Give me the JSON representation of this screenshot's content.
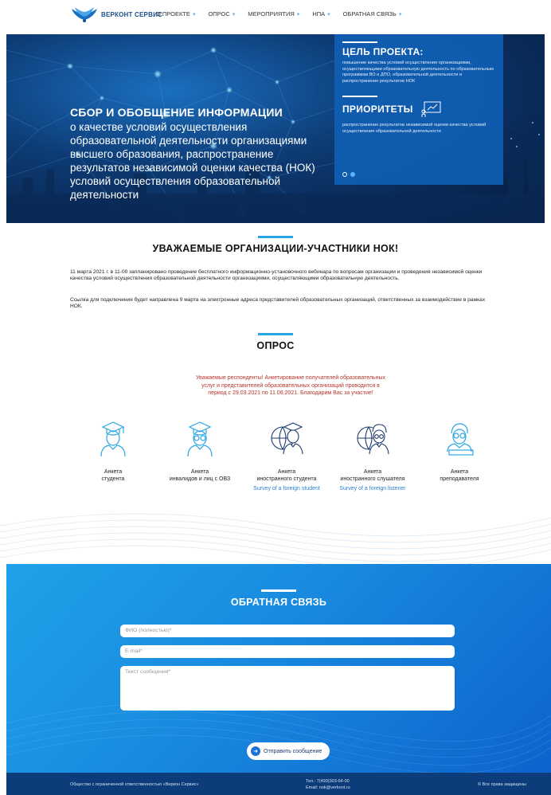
{
  "brand": {
    "name": "ВЕРКОНТ СЕРВИС"
  },
  "nav": {
    "items": [
      {
        "label": "О ПРОЕКТЕ"
      },
      {
        "label": "ОПРОС"
      },
      {
        "label": "МЕРОПРИЯТИЯ"
      },
      {
        "label": "НПА"
      },
      {
        "label": "ОБРАТНАЯ СВЯЗЬ"
      }
    ]
  },
  "hero": {
    "title": "СБОР И ОБОБЩЕНИЕ ИНФОРМАЦИИ",
    "subtitle": "о качестве условий осуществления образовательной деятельности организациями высшего образования, распространение результатов независимой оценки качества (НОК) условий осуществления образовательной деятельности",
    "goal_title": "ЦЕЛЬ ПРОЕКТА:",
    "goal_text": "повышение качества условий осуществления организациями, осуществляющими образовательную деятельность по образовательным программам ВО и ДПО, образовательной деятельности и распространение результатов НОК",
    "priorities_title": "ПРИОРИТЕТЫ",
    "priorities_text": "распространение результатов независимой оценки качества условий осуществления образовательной деятельности",
    "slides": 2,
    "active_slide": 2
  },
  "announcement": {
    "title": "УВАЖАЕМЫЕ ОРГАНИЗАЦИИ-УЧАСТНИКИ НОК!",
    "p1": "11 марта 2021 г. в 11-00 запланировано проведение бесплатного информационно-установочного вебинара по вопросам организации и проведения независимой оценки качества условий осуществления образовательной деятельности организациями, осуществляющими образовательную деятельность.",
    "p2": "Ссылка для подключения будет направлена 9 марта на электронные адреса представителей образовательных организаций, ответственных за взаимодействие в рамках НОК."
  },
  "poll": {
    "title": "ОПРОС",
    "note": "Уважаемые респонденты! Анкетирование получателей образовательных услуг и представителей образовательных организаций проводится в период с 29.03.2021 по 11.06.2021. Благодарим Вас за участие!",
    "surveys": [
      {
        "label": "Анкета\nстудента",
        "english": "",
        "icon": "student-icon"
      },
      {
        "label": "Анкета\nинвалидов и лиц с ОВЗ",
        "english": "",
        "icon": "student-glasses-icon"
      },
      {
        "label": "Анкета\nиностранного студента",
        "english": "Survey of a foreign student",
        "icon": "foreign-student-icon"
      },
      {
        "label": "Анкета\nиностранного слушателя",
        "english": "Survey of a foreign listener",
        "icon": "foreign-listener-icon"
      },
      {
        "label": "Анкета\nпреподавателя",
        "english": "",
        "icon": "teacher-icon"
      }
    ]
  },
  "feedback": {
    "title": "ОБРАТНАЯ СВЯЗЬ",
    "name_placeholder": "ФИО (полностью)*",
    "email_placeholder": "E-mail*",
    "message_placeholder": "Текст сообщения*",
    "send_label": "Отправить сообщение"
  },
  "footer": {
    "company": "Общество с ограниченной ответственностью «Веркон Сервис»",
    "phone": "Тел.: 7(499)303-64-00",
    "email": "Email: nok@verkont.ru",
    "copyright": "© Все права защищены"
  },
  "colors": {
    "accent": "#2aa6e6",
    "hero_box": "#105eb3",
    "note_red": "#b4342a",
    "footer": "#0c3d7a"
  }
}
